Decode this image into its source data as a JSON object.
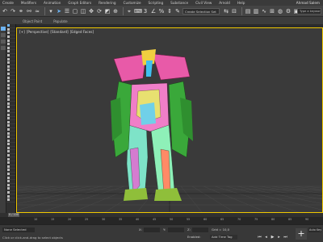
{
  "menu": {
    "items": [
      "Create",
      "Modifiers",
      "Animation",
      "Graph Editors",
      "Rendering",
      "Customize",
      "Scripting",
      "Substance",
      "Civil View",
      "Arnold",
      "Help"
    ],
    "user": "Ahmad Salem"
  },
  "toolbar": {
    "selection_set": "Create Selection Set",
    "search_placeholder": "Type a keyword or phrase"
  },
  "ribbon": {
    "tabs": [
      "Object Paint",
      "Populate"
    ]
  },
  "viewport": {
    "label_plus": "[+]",
    "label_view": "[Perspective]",
    "label_shading": "[Standard]",
    "label_mode": "[Edged Faces]",
    "border_color": "#f0c800"
  },
  "timeline": {
    "current": "0 / 100",
    "ticks": [
      "10",
      "15",
      "20",
      "25",
      "30",
      "35",
      "40",
      "45",
      "50",
      "55",
      "60",
      "65",
      "70",
      "75",
      "80",
      "85",
      "90"
    ]
  },
  "status": {
    "selection": "None Selected",
    "message": "Click or click-and-drag to select objects",
    "x_label": "X:",
    "y_label": "Y:",
    "z_label": "Z:",
    "grid": "Grid = 10,0",
    "add_time_tag": "Add Time Tag",
    "enabled_label": "Enabled:",
    "auto_key": "Auto Key",
    "key_icon": "plus-icon"
  }
}
